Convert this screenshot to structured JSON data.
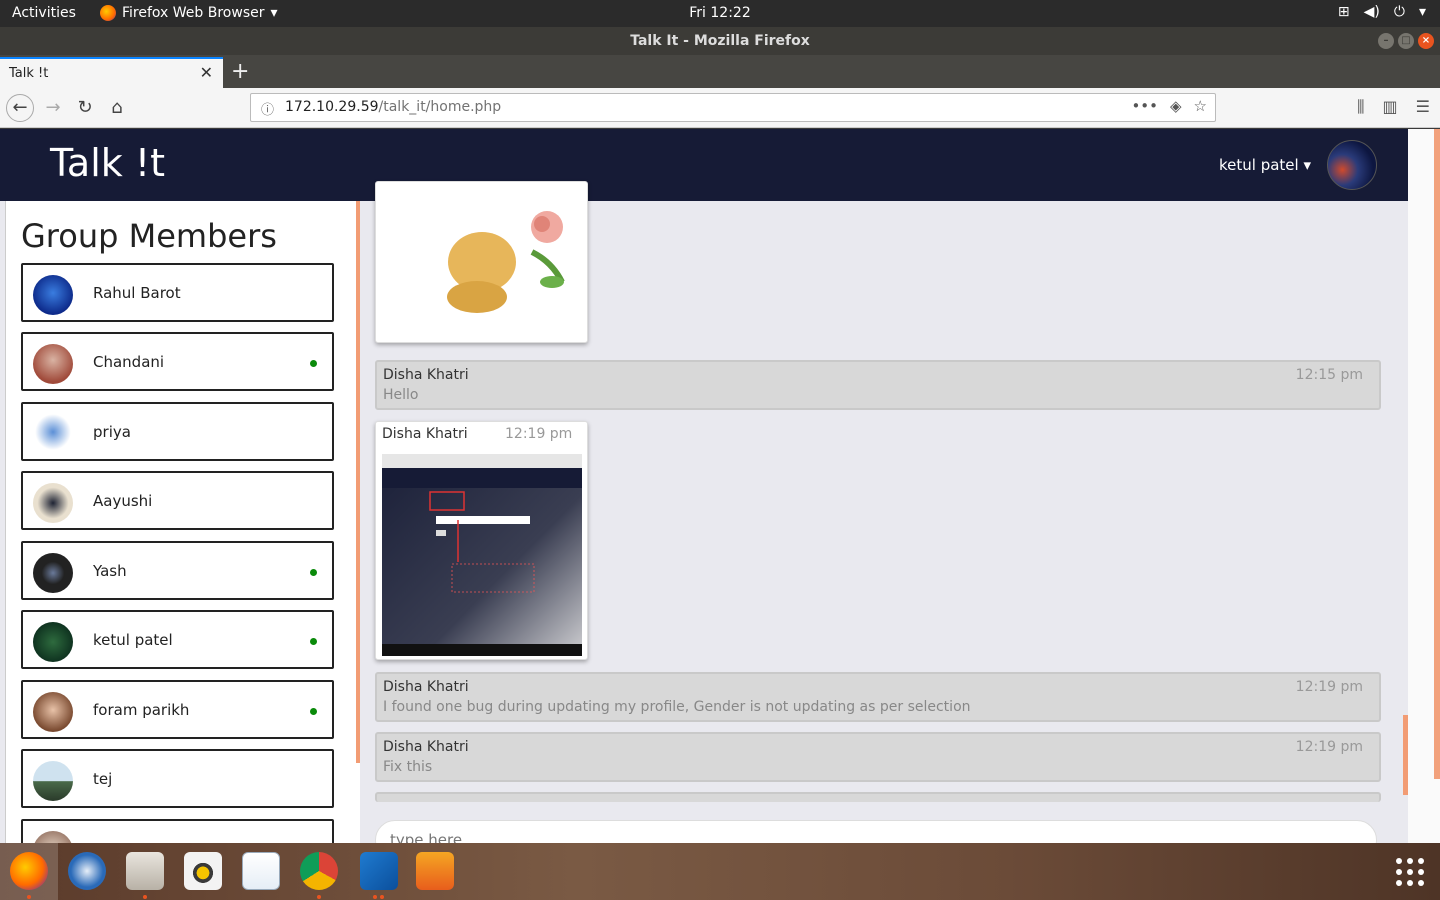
{
  "system": {
    "activities": "Activities",
    "app_menu": "Firefox Web Browser",
    "clock": "Fri 12:22"
  },
  "window": {
    "title": "Talk It - Mozilla Firefox"
  },
  "browser": {
    "tab_title": "Talk !t",
    "url_host": "172.10.29.59",
    "url_path": "/talk_it/home.php"
  },
  "app": {
    "brand": "Talk !t",
    "user_name": "ketul patel"
  },
  "sidebar": {
    "title": "Group Members",
    "members": [
      {
        "name": "Rahul Barot",
        "online": false
      },
      {
        "name": "Chandani",
        "online": true
      },
      {
        "name": "priya",
        "online": false
      },
      {
        "name": "Aayushi",
        "online": false
      },
      {
        "name": "Yash",
        "online": true
      },
      {
        "name": "ketul patel",
        "online": true
      },
      {
        "name": "foram parikh",
        "online": true
      },
      {
        "name": "tej",
        "online": false
      }
    ]
  },
  "chat": {
    "messages": [
      {
        "sender": "Disha Khatri",
        "time": "12:15 pm",
        "text": "Hello"
      },
      {
        "sender": "Disha Khatri",
        "time": "12:19 pm",
        "text": ""
      },
      {
        "sender": "Disha Khatri",
        "time": "12:19 pm",
        "text": "I found one bug during updating my profile, Gender is not updating as per selection"
      },
      {
        "sender": "Disha Khatri",
        "time": "12:19 pm",
        "text": "Fix this"
      }
    ],
    "composer_placeholder": "type here..."
  },
  "colors": {
    "header_bg": "#161b36",
    "accent_scroll": "#f29c74",
    "online_dot": "#0a8a0a"
  }
}
